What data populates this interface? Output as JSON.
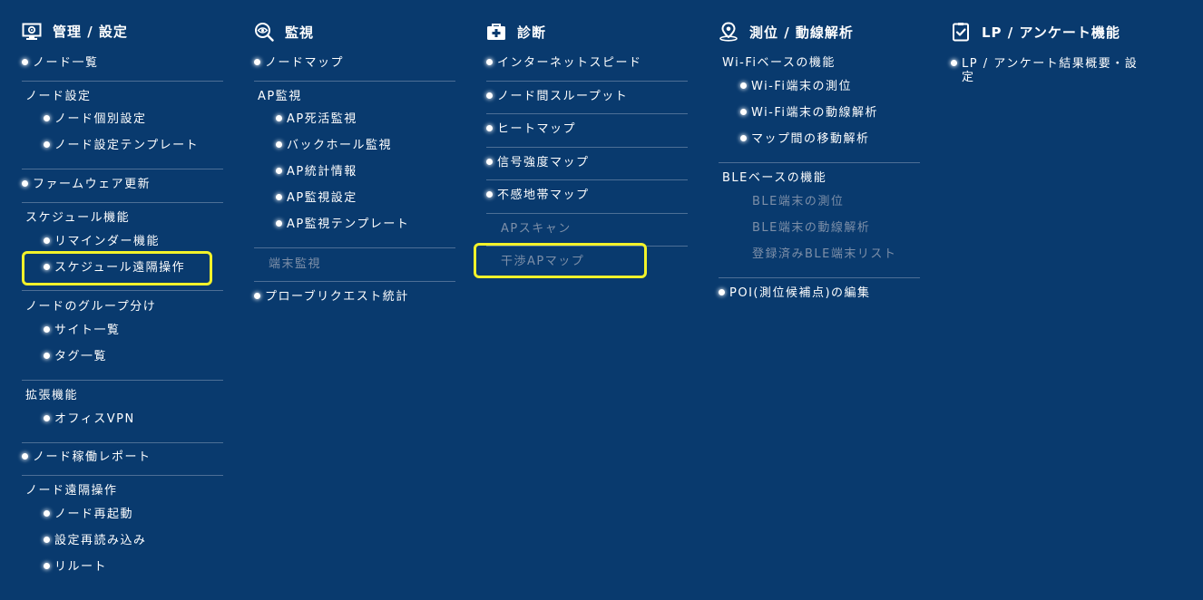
{
  "columns": [
    {
      "title": "管理 / 設定",
      "icon": "monitor-gear-icon",
      "items": [
        {
          "label": "ノード一覧"
        },
        {
          "label": "ノード設定",
          "heading": true
        },
        {
          "label": "ノード個別設定"
        },
        {
          "label": "ノード設定テンプレート"
        },
        {
          "label": "ファームウェア更新"
        },
        {
          "label": "スケジュール機能",
          "heading": true
        },
        {
          "label": "リマインダー機能"
        },
        {
          "label": "スケジュール遠隔操作",
          "highlighted": true
        },
        {
          "label": "ノードのグループ分け",
          "heading": true
        },
        {
          "label": "サイト一覧"
        },
        {
          "label": "タグ一覧"
        },
        {
          "label": "拡張機能",
          "heading": true
        },
        {
          "label": "オフィスVPN"
        },
        {
          "label": "ノード稼働レポート"
        },
        {
          "label": "ノード遠隔操作",
          "heading": true
        },
        {
          "label": "ノード再起動"
        },
        {
          "label": "設定再読み込み"
        },
        {
          "label": "リルート"
        }
      ]
    },
    {
      "title": "監視",
      "icon": "eye-search-icon",
      "items": [
        {
          "label": "ノードマップ"
        },
        {
          "label": "AP監視",
          "heading": true
        },
        {
          "label": "AP死活監視"
        },
        {
          "label": "バックホール監視"
        },
        {
          "label": "AP統計情報"
        },
        {
          "label": "AP監視設定"
        },
        {
          "label": "AP監視テンプレート"
        },
        {
          "label": "端末監視",
          "disabled": true
        },
        {
          "label": "プローブリクエスト統計"
        }
      ]
    },
    {
      "title": "診断",
      "icon": "medical-kit-icon",
      "items": [
        {
          "label": "インターネットスピード"
        },
        {
          "label": "ノード間スループット"
        },
        {
          "label": "ヒートマップ"
        },
        {
          "label": "信号強度マップ"
        },
        {
          "label": "不感地帯マップ"
        },
        {
          "label": "APスキャン",
          "disabled": true
        },
        {
          "label": "干渉APマップ",
          "disabled": true,
          "highlighted": true
        }
      ]
    },
    {
      "title": "測位 / 動線解析",
      "icon": "map-pin-icon",
      "items": [
        {
          "label": "Wi-Fiベースの機能",
          "heading": true
        },
        {
          "label": "Wi-Fi端末の測位"
        },
        {
          "label": "Wi-Fi端末の動線解析"
        },
        {
          "label": "マップ間の移動解析"
        },
        {
          "label": "BLEベースの機能",
          "heading": true
        },
        {
          "label": "BLE端末の測位",
          "disabled": true
        },
        {
          "label": "BLE端末の動線解析",
          "disabled": true
        },
        {
          "label": "登録済みBLE端末リスト",
          "disabled": true
        },
        {
          "label": "POI(測位候補点)の編集"
        }
      ]
    },
    {
      "title": "LP / アンケート機能",
      "icon": "checklist-icon",
      "items": [
        {
          "label": "LP / アンケート結果概要・設"
        },
        {
          "label": "定"
        }
      ]
    }
  ],
  "colors": {
    "background": "#093a6e",
    "highlight": "#f2f22a",
    "disabled_text": "#7d8fa8",
    "divider": "#4d6f96"
  }
}
